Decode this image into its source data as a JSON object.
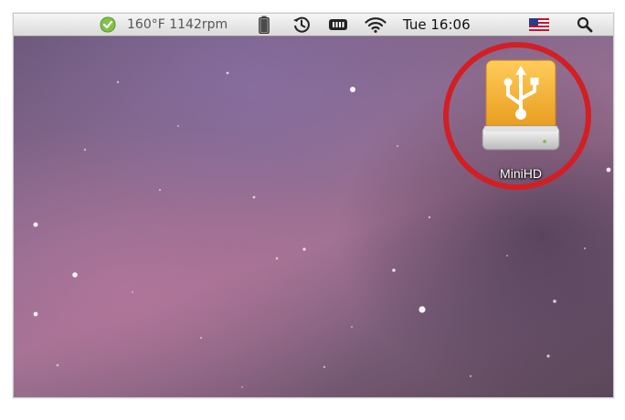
{
  "menubar": {
    "sensor_readout": "160°F 1142rpm",
    "clock": "Tue 16:06",
    "icons": [
      "app-check-icon",
      "battery-vertical-icon",
      "time-machine-icon",
      "ram-chip-icon",
      "wifi-icon",
      "us-flag-icon",
      "spotlight-search-icon"
    ]
  },
  "desktop": {
    "drive_icon": "usb-drive-icon",
    "drive_label": "MiniHD"
  },
  "colors": {
    "highlight_ring": "#d21f24",
    "drive_body": "#f3ac2b",
    "menubar_top": "#f6f6f6",
    "menubar_bottom": "#dadada"
  }
}
